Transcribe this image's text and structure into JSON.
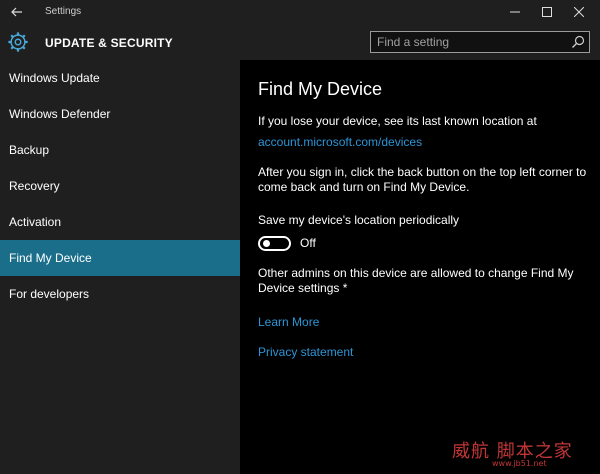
{
  "window": {
    "title": "Settings"
  },
  "header": {
    "title": "UPDATE & SECURITY",
    "icon": "gear-icon",
    "search_placeholder": "Find a setting"
  },
  "sidebar": {
    "items": [
      {
        "label": "Windows Update"
      },
      {
        "label": "Windows Defender"
      },
      {
        "label": "Backup"
      },
      {
        "label": "Recovery"
      },
      {
        "label": "Activation"
      },
      {
        "label": "Find My Device",
        "selected": true
      },
      {
        "label": "For developers"
      }
    ]
  },
  "main": {
    "title": "Find My Device",
    "intro": "If you lose your device, see its last known location at",
    "account_link": "account.microsoft.com/devices",
    "sign_in_note": "After you sign in, click the back button on the top left corner to come back and turn on Find My Device.",
    "toggle_label": "Save my device's location periodically",
    "toggle_state": "Off",
    "admins_note": "Other admins on this device are allowed to change Find My Device settings *",
    "learn_more": "Learn More",
    "privacy": "Privacy statement"
  },
  "watermark": {
    "text": "威航 脚本之家",
    "sub": "www.jb51.net"
  },
  "colors": {
    "accent": "#1a6e8a",
    "link": "#2b95d6",
    "background": "#000000",
    "panel": "#1f1f1f"
  }
}
